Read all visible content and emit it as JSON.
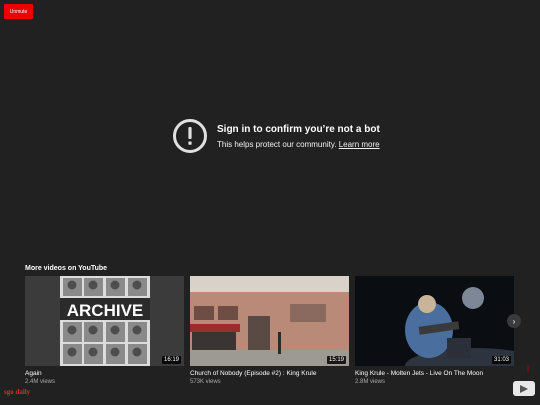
{
  "player": {
    "unmute_label": "Unmute"
  },
  "notice": {
    "title": "Sign in to confirm you’re not a bot",
    "subtitle": "This helps protect our community.",
    "learn_more": "Learn more",
    "icon": "alert-circle-icon"
  },
  "more_videos": {
    "heading": "More videos on YouTube",
    "videos": [
      {
        "title": "Again",
        "views": "2.4M views",
        "duration": "16:19",
        "thumb_text": "ARCHIVE"
      },
      {
        "title": "Church of Nobody (Episode #2) : King Krule",
        "views": "573K views",
        "duration": "15:19"
      },
      {
        "title": "King Krule - Molten Jets - Live On The Moon",
        "views": "2.8M views",
        "duration": "31:03"
      }
    ],
    "next_icon": "chevron-right-icon"
  },
  "branding": {
    "logo_icon": "youtube-logo-icon",
    "watermark": "sgo daily",
    "corner_mark": "|"
  },
  "colors": {
    "background": "#212121",
    "unmute_red": "#ee0000",
    "watermark_red": "#c0392b"
  }
}
